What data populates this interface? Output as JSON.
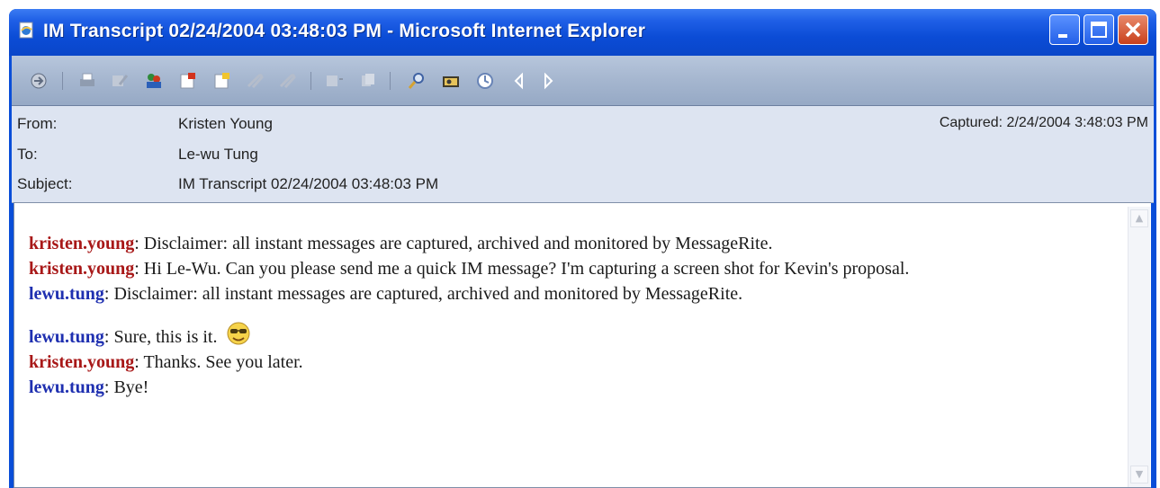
{
  "window": {
    "title": "IM Transcript 02/24/2004 03:48:03 PM - Microsoft Internet Explorer",
    "controls": [
      "minimize-icon",
      "maximize-icon",
      "close-icon"
    ]
  },
  "toolbar": {
    "icons": [
      "reply-icon",
      "print-icon",
      "edit-icon",
      "contacts-icon",
      "flag-icon",
      "note-icon",
      "attach-icon",
      "attach-alt-icon",
      "forward-icon",
      "copy-icon",
      "search-icon",
      "camera-icon",
      "refresh-icon",
      "previous-icon",
      "next-icon"
    ]
  },
  "header": {
    "from_label": "From:",
    "from_value": "Kristen Young",
    "to_label": "To:",
    "to_value": "Le-wu Tung",
    "subject_label": "Subject:",
    "subject_value": "IM Transcript 02/24/2004 03:48:03 PM",
    "captured": "Captured: 2/24/2004 3:48:03 PM"
  },
  "messages": [
    {
      "sender": "kristen.young",
      "text": ": Disclaimer: all instant messages are captured, archived and monitored by MessageRite.",
      "color": "#a81818"
    },
    {
      "sender": "kristen.young",
      "text": ": Hi Le-Wu. Can you please send me a quick IM message? I'm capturing a screen shot for Kevin's proposal.",
      "color": "#a81818"
    },
    {
      "sender": "lewu.tung",
      "text": ": Disclaimer: all instant messages are captured, archived and monitored by MessageRite.",
      "color": "#1e2fb0"
    },
    {
      "sender": "lewu.tung",
      "text": ": Sure, this is it.",
      "color": "#1e2fb0",
      "emoticon": "cool-smiley-icon"
    },
    {
      "sender": "kristen.young",
      "text": ": Thanks. See you later.",
      "color": "#a81818"
    },
    {
      "sender": "lewu.tung",
      "text": ": Bye!",
      "color": "#1e2fb0"
    }
  ],
  "scrollbar": {
    "up": "scroll-up-icon",
    "down": "scroll-down-icon"
  }
}
